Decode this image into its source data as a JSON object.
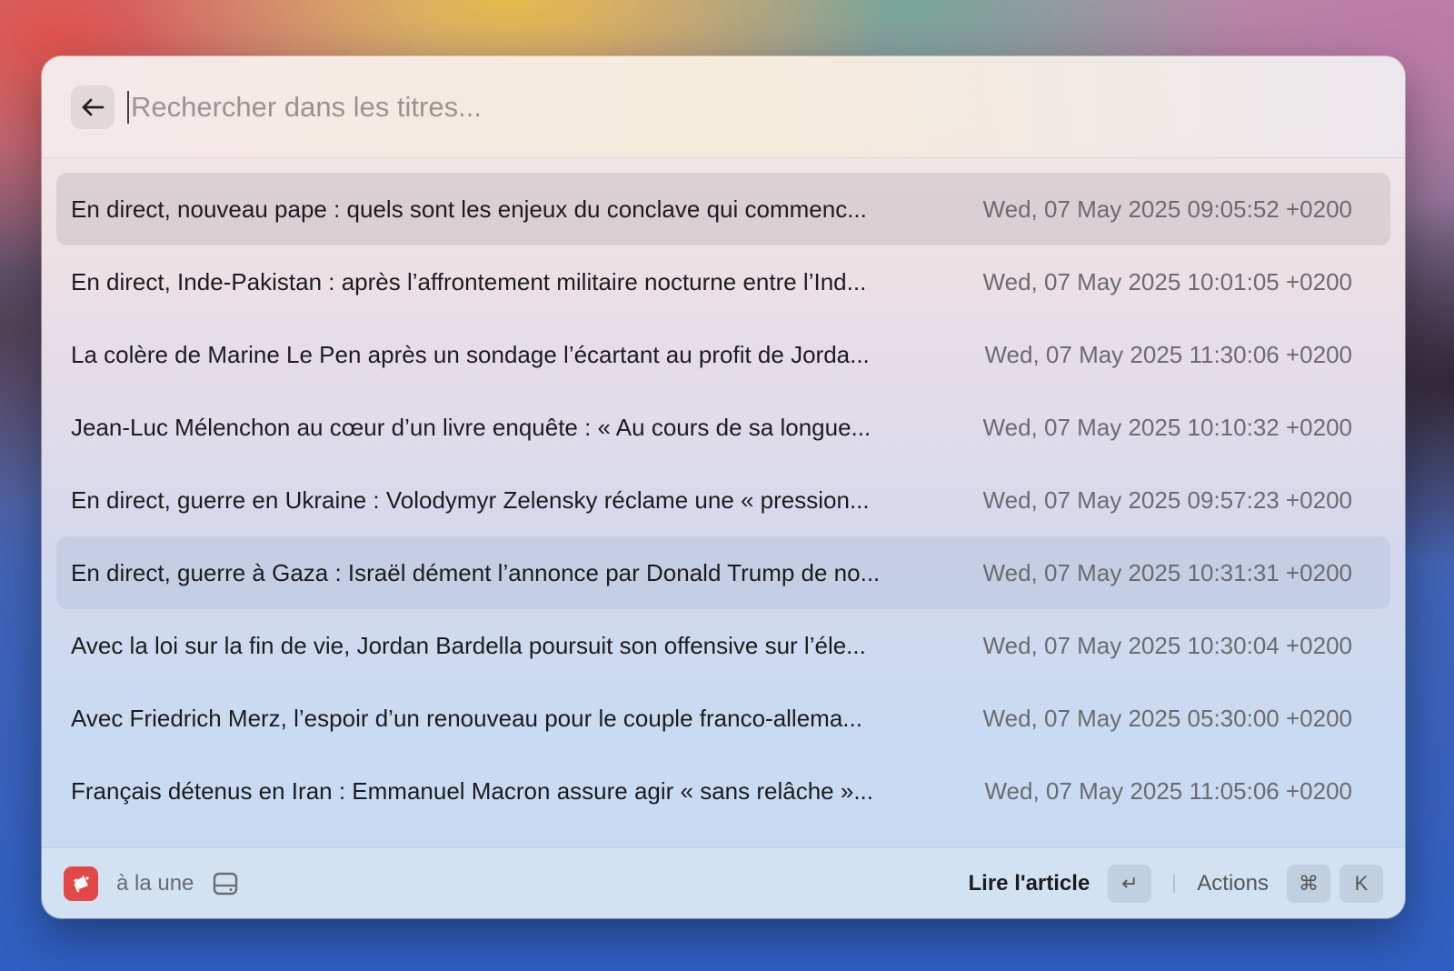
{
  "search": {
    "placeholder": "Rechercher dans les titres...",
    "value": ""
  },
  "icons": {
    "back": "arrow-left-icon",
    "app": "news-app-icon",
    "drive": "hard-drive-icon",
    "enter": "return-key-icon"
  },
  "articles": [
    {
      "title": "En direct, nouveau pape : quels sont les enjeux du conclave qui commenc...",
      "date": "Wed, 07 May 2025 09:05:52 +0200"
    },
    {
      "title": "En direct, Inde-Pakistan : après l’affrontement militaire nocturne entre l’Ind...",
      "date": "Wed, 07 May 2025 10:01:05 +0200"
    },
    {
      "title": "La colère de Marine Le Pen après un sondage l’écartant au profit de Jorda...",
      "date": "Wed, 07 May 2025 11:30:06 +0200"
    },
    {
      "title": "Jean-Luc Mélenchon au cœur d’un livre enquête : « Au cours de sa longue...",
      "date": "Wed, 07 May 2025 10:10:32 +0200"
    },
    {
      "title": "En direct, guerre en Ukraine : Volodymyr Zelensky réclame une « pression...",
      "date": "Wed, 07 May 2025 09:57:23 +0200"
    },
    {
      "title": "En direct, guerre à Gaza : Israël dément l’annonce par Donald Trump de no...",
      "date": "Wed, 07 May 2025 10:31:31 +0200"
    },
    {
      "title": "Avec la loi sur la fin de vie, Jordan Bardella poursuit son offensive sur l’éle...",
      "date": "Wed, 07 May 2025 10:30:04 +0200"
    },
    {
      "title": "Avec Friedrich Merz, l’espoir d’un renouveau pour le couple franco-allema...",
      "date": "Wed, 07 May 2025 05:30:00 +0200"
    },
    {
      "title": "Français détenus en Iran : Emmanuel Macron assure agir « sans relâche »...",
      "date": "Wed, 07 May 2025 11:05:06 +0200"
    }
  ],
  "selected_index": 0,
  "hovered_index": 5,
  "footer": {
    "source_label": "à la une",
    "primary_action": "Lire l'article",
    "primary_key": "↵",
    "secondary_action": "Actions",
    "secondary_keys": [
      "⌘",
      "K"
    ]
  },
  "colors": {
    "app_icon_bg": "#e34848"
  }
}
